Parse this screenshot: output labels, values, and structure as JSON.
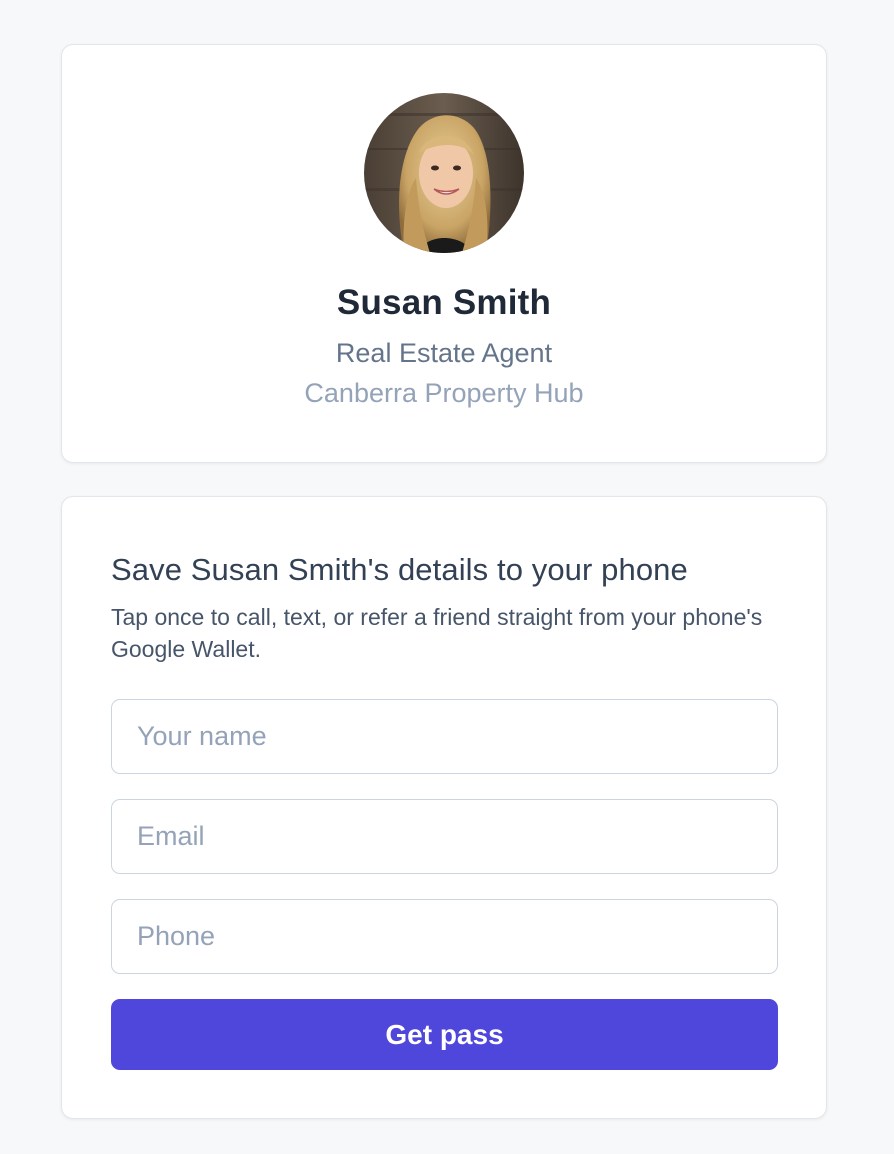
{
  "profile": {
    "name": "Susan Smith",
    "role": "Real Estate Agent",
    "company": "Canberra Property Hub",
    "avatar_alt": "Susan Smith"
  },
  "form": {
    "heading": "Save Susan Smith's details to your phone",
    "description": "Tap once to call, text, or refer a friend straight from your phone's Google Wallet.",
    "fields": {
      "name": {
        "placeholder": "Your name",
        "value": ""
      },
      "email": {
        "placeholder": "Email",
        "value": ""
      },
      "phone": {
        "placeholder": "Phone",
        "value": ""
      }
    },
    "submit_label": "Get pass"
  },
  "colors": {
    "accent": "#4f46dc",
    "background": "#f7f8fa",
    "card": "#ffffff"
  }
}
